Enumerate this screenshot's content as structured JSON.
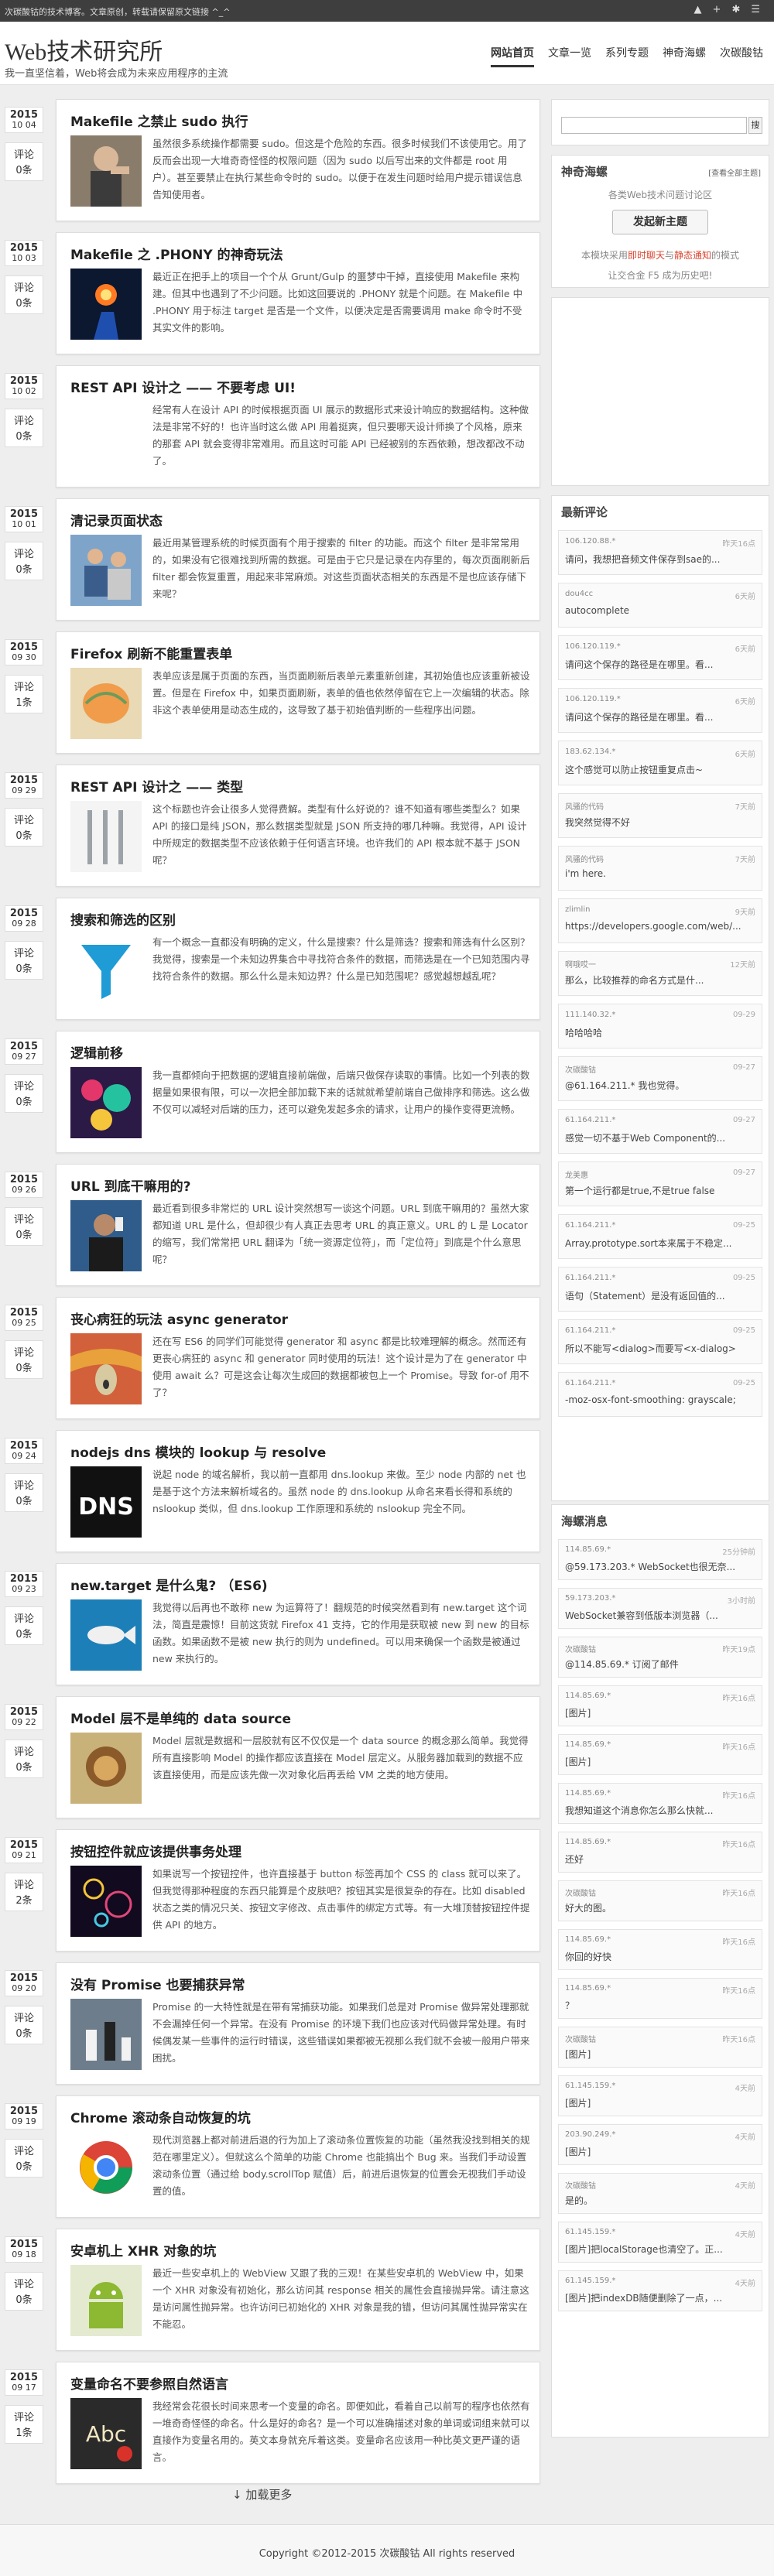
{
  "topbar": {
    "notice": "次碳酸钴的技术博客。文章原创，转载请保留原文链接 ^_^",
    "icons": [
      "triangle-icon",
      "plus-icon",
      "gear-icon",
      "menu-icon"
    ]
  },
  "header": {
    "title": "Web技术研究所",
    "subtitle": "我一直坚信着，Web将会成为未来应用程序的主流",
    "nav": [
      {
        "label": "网站首页",
        "active": true
      },
      {
        "label": "文章一览"
      },
      {
        "label": "系列专题"
      },
      {
        "label": "神奇海螺"
      },
      {
        "label": "次碳酸钴"
      }
    ]
  },
  "posts": [
    {
      "year": "2015",
      "day": "10 04",
      "cmt_label": "评论",
      "cmt": "0条",
      "title": "Makefile 之禁止 sudo 执行",
      "thumb": "man-hand",
      "excerpt": "虽然很多系统操作都需要 sudo。但这是个危险的东西。很多时候我们不该使用它。用了反而会出现一大堆奇奇怪怪的权限问题（因为 sudo 以后写出来的文件都是 root 用户）。甚至要禁止在执行某些命令时的 sudo。以便于在发生问题时给用户提示错误信息告知使用者。"
    },
    {
      "year": "2015",
      "day": "10 03",
      "cmt_label": "评论",
      "cmt": "0条",
      "title": "Makefile 之 .PHONY 的神奇玩法",
      "thumb": "magic-hand",
      "excerpt": "最近正在把手上的项目一个个从 Grunt/Gulp 的噩梦中干掉，直接使用 Makefile 来构建。但其中也遇到了不少问题。比如这回要说的 .PHONY 就是个问题。在 Makefile 中 .PHONY 用于标注 target 是否是一个文件，以便决定是否需要调用 make 命令时不受其实文件的影响。"
    },
    {
      "year": "2015",
      "day": "10 02",
      "cmt_label": "评论",
      "cmt": "0条",
      "title": "REST API 设计之 —— 不要考虑 UI!",
      "thumb": "blank",
      "excerpt": "经常有人在设计 API 的时候根据页面 UI 展示的数据形式来设计响应的数据结构。这种做法是非常不好的！也许当时这么做 API 用着挺爽，但只要哪天设计师换了个风格，原来的那套 API 就会变得非常难用。而且这时可能 API 已经被别的东西依赖，想改都改不动了。"
    },
    {
      "year": "2015",
      "day": "10 01",
      "cmt_label": "评论",
      "cmt": "0条",
      "title": "清记录页面状态",
      "thumb": "workers",
      "excerpt": "最近用某管理系统的时候页面有个用于搜索的 filter 的功能。而这个 filter 是非常常用的，如果没有它很难找到所需的数据。可是由于它只是记录在内存里的，每次页面刷新后 filter 都会恢复重置，用起来非常麻烦。对这些页面状态相关的东西是不是也应该存储下来呢？"
    },
    {
      "year": "2015",
      "day": "09 30",
      "cmt_label": "评论",
      "cmt": "1条",
      "title": "Firefox 刷新不能重置表单",
      "thumb": "brain",
      "excerpt": "表单应该是属于页面的东西，当页面刷新后表单元素重新创建，其初始值也应该重新被设置。但是在 Firefox 中，如果页面刷新，表单的值也依然停留在它上一次编辑的状态。除非这个表单使用是动态生成的，这导致了基于初始值判断的一些程序出问题。"
    },
    {
      "year": "2015",
      "day": "09 29",
      "cmt_label": "评论",
      "cmt": "0条",
      "title": "REST API 设计之 —— 类型",
      "thumb": "cutlery",
      "excerpt": "这个标题也许会让很多人觉得费解。类型有什么好说的？谁不知道有哪些类型么？如果 API 的接口是纯 JSON，那么数据类型就是 JSON 所支持的哪几种嘛。我觉得，API 设计中所规定的数据类型不应该依赖于任何语言环境。也许我们的 API 根本就不基于 JSON 呢？"
    },
    {
      "year": "2015",
      "day": "09 28",
      "cmt_label": "评论",
      "cmt": "0条",
      "title": "搜索和筛选的区别",
      "thumb": "funnel",
      "excerpt": "有一个概念一直都没有明确的定义，什么是搜索？什么是筛选？搜索和筛选有什么区别？我觉得，搜索是一个未知边界集合中寻找符合条件的数据，而筛选是在一个已知范围内寻找符合条件的数据。那么什么是未知边界？什么是已知范围呢？感觉越想越乱呢？"
    },
    {
      "year": "2015",
      "day": "09 27",
      "cmt_label": "评论",
      "cmt": "0条",
      "title": "逻辑前移",
      "thumb": "colorful",
      "excerpt": "我一直都倾向于把数据的逻辑直接前端做，后端只做保存读取的事情。比如一个列表的数据量如果很有限，可以一次把全部加载下来的话就就希望前端自己做排序和筛选。这么做不仅可以减轻对后端的压力，还可以避免发起多余的请求，让用户的操作变得更流畅。"
    },
    {
      "year": "2015",
      "day": "09 26",
      "cmt_label": "评论",
      "cmt": "0条",
      "title": "URL 到底干嘛用的?",
      "thumb": "phone-man",
      "excerpt": "最近看到很多非常烂的 URL 设计突然想写一谈这个问题。URL 到底干嘛用的？虽然大家都知道 URL 是什么，但却很少有人真正去思考 URL 的真正意义。URL 的 L 是 Locator 的缩写，我们常常把 URL 翻译为「统一资源定位符」，而「定位符」到底是个什么意思呢？"
    },
    {
      "year": "2015",
      "day": "09 25",
      "cmt_label": "评论",
      "cmt": "0条",
      "title": "丧心病狂的玩法 async generator",
      "thumb": "scream",
      "excerpt": "还在写 ES6 的同学们可能觉得 generator 和 async 都是比较难理解的概念。然而还有更丧心病狂的 async 和 generator 同时使用的玩法！这个设计是为了在 generator 中使用 await 么？可是这会让每次生成回的数据都被包上一个 Promise。导致 for-of 用不了？"
    },
    {
      "year": "2015",
      "day": "09 24",
      "cmt_label": "评论",
      "cmt": "0条",
      "title": "nodejs dns 模块的 lookup 与 resolve",
      "thumb": "dns",
      "excerpt": "说起 node 的域名解析，我以前一直都用 dns.lookup 来做。至少 node 内部的 net 也是基于这个方法来解析域名的。虽然 node 的 dns.lookup 从命名来看长得和系统的 nslookup 类似，但 dns.lookup 工作原理和系统的 nslookup 完全不同。"
    },
    {
      "year": "2015",
      "day": "09 23",
      "cmt_label": "评论",
      "cmt": "0条",
      "title": "new.target 是什么鬼? （ES6)",
      "thumb": "fish",
      "excerpt": "我觉得以后再也不敢称 new 为运算符了！翻规范的时候突然看到有 new.target 这个词法，简直是震惊！目前这货就 Firefox 41 支持，它的作用是获取被 new 到 new 的目标函数。如果函数不是被 new 执行的则为 undefined。可以用来确保一个函数是被通过 new 来执行的。"
    },
    {
      "year": "2015",
      "day": "09 22",
      "cmt_label": "评论",
      "cmt": "0条",
      "title": "Model 层不是单纯的 data source",
      "thumb": "lion",
      "excerpt": "Model 层就是数据和一层胶就有区不仅仅是一个 data source 的概念那么简单。我觉得所有直接影响 Model 的操作都应该直接在 Model 层定义。从服务器加载到的数据不应该直接使用，而是应该先做一次对象化后再丢给 VM 之类的地方使用。"
    },
    {
      "year": "2015",
      "day": "09 21",
      "cmt_label": "评论",
      "cmt": "2条",
      "title": "按钮控件就应该提供事务处理",
      "thumb": "fireworks",
      "excerpt": "如果说写一个按钮控件，也许直接基于 button 标签再加个 CSS 的 class 就可以来了。但我觉得那种程度的东西只能算是个皮肤吧？按钮其实是很复杂的存在。比如 disabled 状态之类的情况只关、按钮文字修改、点击事件的绑定方式等。有一大堆顶替按钮控件提供 API 的地方。"
    },
    {
      "year": "2015",
      "day": "09 20",
      "cmt_label": "评论",
      "cmt": "0条",
      "title": "没有 Promise 也要捕获异常",
      "thumb": "chess",
      "excerpt": "Promise 的一大特性就是在带有常捕获功能。如果我们总是对 Promise 做异常处理那就不会漏掉任何一个异常。在没有 Promise 的环境下我们也应该对代码做异常处理。有时候偶发某一些事件的运行时错误，这些错误如果都被无视那么我们就不会被一般用户带来困扰。"
    },
    {
      "year": "2015",
      "day": "09 19",
      "cmt_label": "评论",
      "cmt": "0条",
      "title": "Chrome 滚动条自动恢复的坑",
      "thumb": "chrome",
      "excerpt": "现代浏览器上都对前进后退的行为加上了滚动条位置恢复的功能（虽然我没找到相关的规范在哪里定义）。但就这么个简单的功能 Chrome 也能搞出个 Bug 来。当我们手动设置滚动条位置（通过给 body.scrollTop 赋值）后，前进后退恢复的位置会无视我们手动设置的值。"
    },
    {
      "year": "2015",
      "day": "09 18",
      "cmt_label": "评论",
      "cmt": "0条",
      "title": "安卓机上 XHR 对象的坑",
      "thumb": "android",
      "excerpt": "最近一些安卓机上的 WebView 又跟了我的三观！在某些安卓机的 WebView 中，如果一个 XHR 对象没有初始化，那么访问其 response 相关的属性会直接抛异常。请注意这是访问属性抛异常。也许访问已初始化的 XHR 对象是我的错，但访问其属性抛异常实在不能忍。"
    },
    {
      "year": "2015",
      "day": "09 17",
      "cmt_label": "评论",
      "cmt": "1条",
      "title": "变量命名不要参照自然语言",
      "thumb": "abc",
      "excerpt": "我经常会花很长时间来思考一个变量的命名。即便如此，看着自己以前写的程序也依然有一堆奇奇怪怪的命名。什么是好的命名？是一个可以准确描述对象的单词或词组来就可以直接作为变量名用的。英文本身就充斥着这类。变量命名应该用一种比英文更严谨的语言。"
    }
  ],
  "load_more": "↓ 加载更多",
  "footer": "Copyright ©2012-2015 次碳酸钴 All rights reserved",
  "search": {
    "button": "搜"
  },
  "hailuo": {
    "title": "神奇海螺",
    "link": "[查看全部主题]",
    "line1": "各类Web技术问题讨论区",
    "button": "发起新主题",
    "line2a": "本模块采用",
    "line2b": "即时聊天",
    "line2c": "与",
    "line2d": "静态通知",
    "line2e": "的模式",
    "line3": "让交合金 F5 成为历史吧!"
  },
  "comments": {
    "title": "最新评论",
    "items": [
      {
        "user": "106.120.88.*",
        "time": "昨天16点",
        "text": "请问，我想把音频文件保存到sae的..."
      },
      {
        "user": "dou4cc",
        "time": "6天前",
        "text": "autocomplete"
      },
      {
        "user": "106.120.119.*",
        "time": "6天前",
        "text": "请问这个保存的路径是在哪里。看..."
      },
      {
        "user": "106.120.119.*",
        "time": "6天前",
        "text": "请问这个保存的路径是在哪里。看..."
      },
      {
        "user": "183.62.134.*",
        "time": "6天前",
        "text": "这个感觉可以防止按钮重复点击~"
      },
      {
        "user": "风骚的代码",
        "time": "7天前",
        "text": "我突然觉得不好"
      },
      {
        "user": "风骚的代码",
        "time": "7天前",
        "text": "i'm here."
      },
      {
        "user": "zlimlin",
        "time": "9天前",
        "text": "https://developers.google.com/web/..."
      },
      {
        "user": "啊哦哎一",
        "time": "12天前",
        "text": "那么，比较推荐的命名方式是什..."
      },
      {
        "user": "111.140.32.*",
        "time": "09-29",
        "text": "哈哈哈哈"
      },
      {
        "user": "次碳酸钴",
        "time": "09-27",
        "text": "@61.164.211.* 我也觉得。"
      },
      {
        "user": "61.164.211.*",
        "time": "09-27",
        "text": "感觉一切不基于Web Component的..."
      },
      {
        "user": "龙美惠",
        "time": "09-27",
        "text": "第一个运行都是true,不是true false"
      },
      {
        "user": "61.164.211.*",
        "time": "09-25",
        "text": "Array.prototype.sort本来属于不稳定..."
      },
      {
        "user": "61.164.211.*",
        "time": "09-25",
        "text": "语句（Statement）是没有返回值的..."
      },
      {
        "user": "61.164.211.*",
        "time": "09-25",
        "text": "所以不能写<dialog>而要写<x-dialog>"
      },
      {
        "user": "61.164.211.*",
        "time": "09-25",
        "text": "-moz-osx-font-smoothing: grayscale;"
      }
    ]
  },
  "messages": {
    "title": "海螺消息",
    "items": [
      {
        "user": "114.85.69.*",
        "time": "25分钟前",
        "text": "@59.173.203.* WebSocket也很无奈..."
      },
      {
        "user": "59.173.203.*",
        "time": "3小时前",
        "text": "WebSocket兼容到低版本浏览器（..."
      },
      {
        "user": "次碳酸钴",
        "time": "昨天19点",
        "text": "@114.85.69.* 订阅了邮件"
      },
      {
        "user": "114.85.69.*",
        "time": "昨天16点",
        "text": "[图片]"
      },
      {
        "user": "114.85.69.*",
        "time": "昨天16点",
        "text": "[图片]"
      },
      {
        "user": "114.85.69.*",
        "time": "昨天16点",
        "text": "我想知道这个消息你怎么那么快就..."
      },
      {
        "user": "114.85.69.*",
        "time": "昨天16点",
        "text": "还好"
      },
      {
        "user": "次碳酸钴",
        "time": "昨天16点",
        "text": "好大的图。"
      },
      {
        "user": "114.85.69.*",
        "time": "昨天16点",
        "text": "你回的好快"
      },
      {
        "user": "114.85.69.*",
        "time": "昨天16点",
        "text": "？"
      },
      {
        "user": "次碳酸钴",
        "time": "昨天16点",
        "text": "[图片]"
      },
      {
        "user": "61.145.159.*",
        "time": "4天前",
        "text": "[图片]"
      },
      {
        "user": "203.90.249.*",
        "time": "4天前",
        "text": "[图片]"
      },
      {
        "user": "次碳酸钴",
        "time": "4天前",
        "text": "是的。"
      },
      {
        "user": "61.145.159.*",
        "time": "4天前",
        "text": "[图片]把localStorage也清空了。正..."
      },
      {
        "user": "61.145.159.*",
        "time": "4天前",
        "text": "[图片]把indexDB随便删除了一点，..."
      }
    ]
  }
}
